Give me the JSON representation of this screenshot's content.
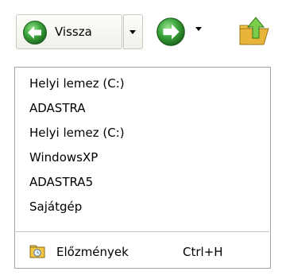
{
  "toolbar": {
    "back_label": "Vissza",
    "back_icon": "back-arrow-icon",
    "forward_icon": "forward-arrow-icon",
    "up_icon": "folder-up-icon"
  },
  "menu": {
    "items": [
      {
        "label": "Helyi lemez (C:)"
      },
      {
        "label": "ADASTRA"
      },
      {
        "label": "Helyi lemez (C:)"
      },
      {
        "label": "WindowsXP"
      },
      {
        "label": "ADASTRA5"
      },
      {
        "label": "Sajátgép"
      }
    ],
    "history": {
      "label": "Előzmények",
      "shortcut": "Ctrl+H",
      "icon": "history-icon"
    }
  },
  "colors": {
    "back_green": "#3aa33a",
    "menu_border": "#a5a5a5",
    "folder_yellow": "#f4c542"
  }
}
